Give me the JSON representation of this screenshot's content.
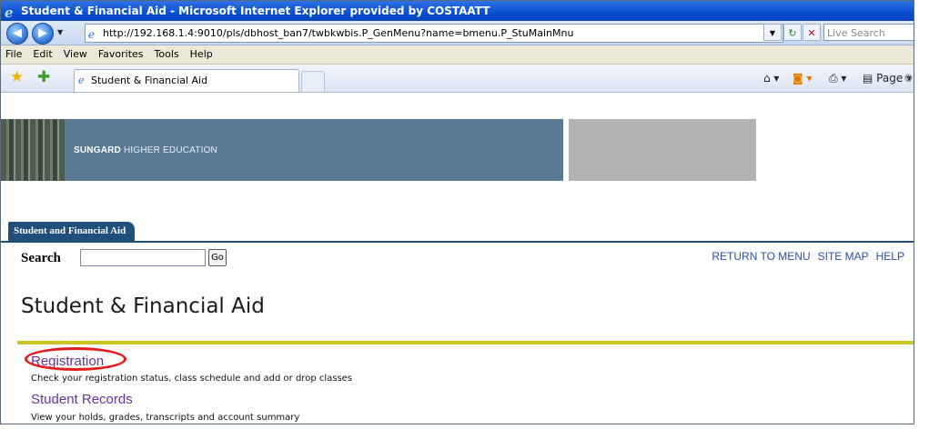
{
  "window": {
    "title": "Student & Financial Aid - Microsoft Internet Explorer provided by COSTAATT"
  },
  "address_bar": {
    "url": "http://192.168.1.4:9010/pls/dbhost_ban7/twbkwbis.P_GenMenu?name=bmenu.P_StuMainMnu",
    "search_placeholder": "Live Search"
  },
  "menu": {
    "items": [
      "File",
      "Edit",
      "View",
      "Favorites",
      "Tools",
      "Help"
    ]
  },
  "tabs": {
    "active_tab": "Student & Financial Aid",
    "page_button": "Page"
  },
  "banner": {
    "brand_bold": "SUNGARD",
    "brand_rest": "HIGHER EDUCATION"
  },
  "app": {
    "tab_label": "Student and Financial Aid",
    "search_label": "Search",
    "go_label": "Go",
    "top_links": [
      "RETURN TO MENU",
      "SITE MAP",
      "HELP"
    ],
    "page_title": "Student & Financial Aid",
    "links": [
      {
        "label": "Registration",
        "description": "Check your registration status, class schedule and add or drop classes"
      },
      {
        "label": "Student Records",
        "description": "View your holds, grades, transcripts and account summary"
      }
    ]
  },
  "colors": {
    "accent_navy": "#1f4f7a",
    "banner_blue": "#5a7a94",
    "rule_yellow": "#c9c421",
    "link_purple": "#663399",
    "highlight_red": "#e21c1c"
  },
  "icons": [
    "ie-logo-icon",
    "back-arrow-icon",
    "forward-arrow-icon",
    "page-icon",
    "refresh-icon",
    "stop-icon",
    "favorites-star-icon",
    "add-favorites-icon",
    "home-icon",
    "feeds-icon",
    "print-icon",
    "page-menu-icon",
    "tools-gear-icon"
  ]
}
